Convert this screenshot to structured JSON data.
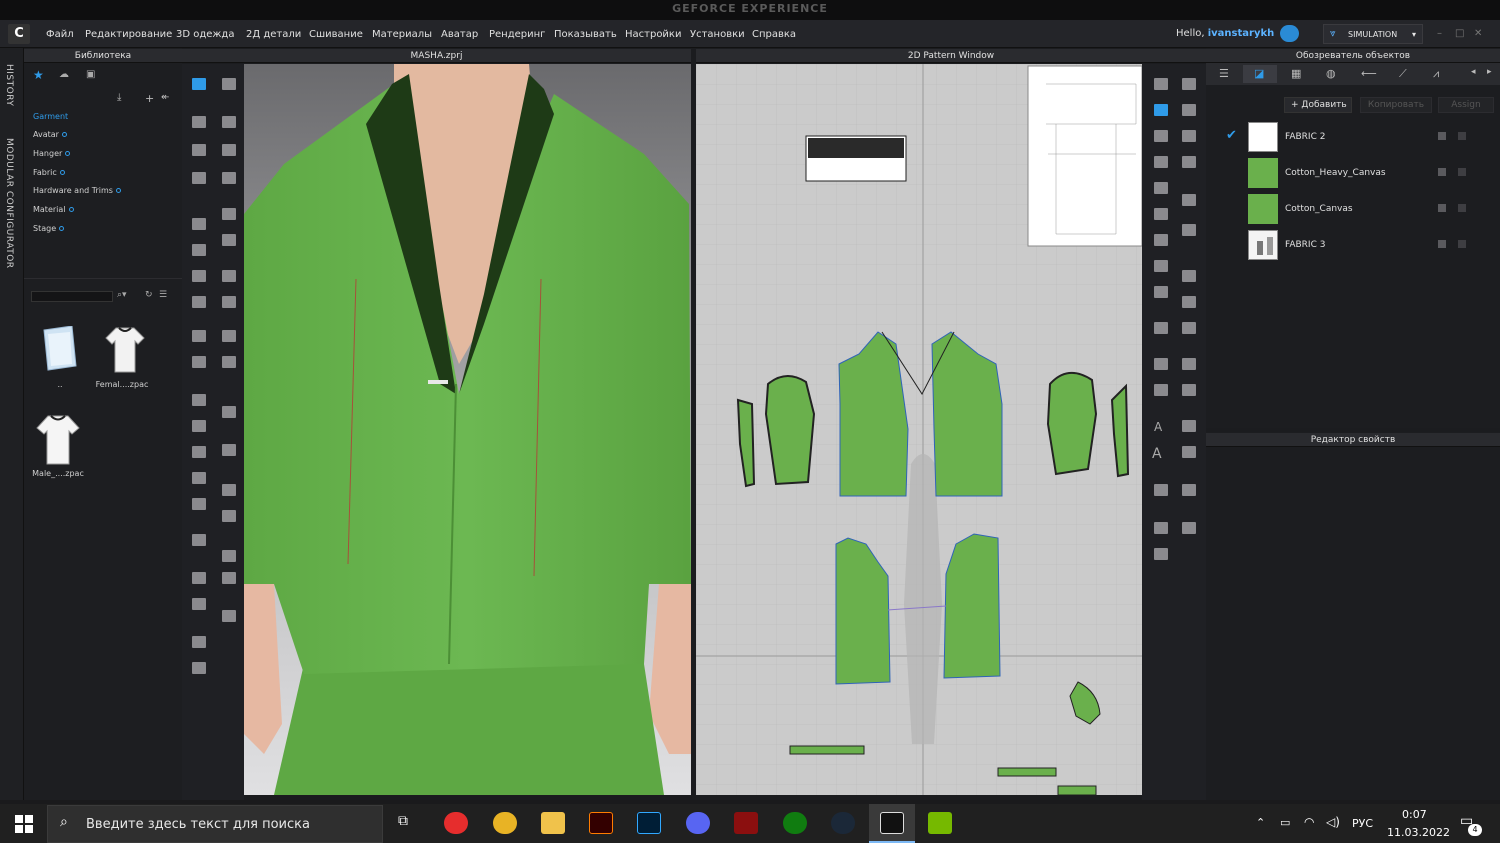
{
  "overlay": {
    "brand": "GEFORCE EXPERIENCE"
  },
  "app": {
    "logo": "C"
  },
  "menu": [
    "Файл",
    "Редактирование",
    "3D одежда",
    "2Д детали",
    "Сшивание",
    "Материалы",
    "Аватар",
    "Рендеринг",
    "Показывать",
    "Настройки",
    "Установки",
    "Справка"
  ],
  "user": {
    "greeting": "Hello,",
    "name": "ivanstarykh"
  },
  "mode": {
    "label": "SIMULATION"
  },
  "side_tabs": {
    "history": "HISTORY",
    "modular": "MODULAR CONFIGURATOR"
  },
  "library": {
    "title": "Библиотека",
    "items": [
      "Garment",
      "Avatar",
      "Hanger",
      "Fabric",
      "Hardware and Trims",
      "Material",
      "Stage"
    ],
    "active_item": "Garment",
    "files": [
      {
        "label": "..",
        "icon": "folder-icon"
      },
      {
        "label": "Femal....zpac",
        "icon": "female-tshirt-icon"
      },
      {
        "label": "Male_....zpac",
        "icon": "male-tshirt-icon"
      }
    ]
  },
  "view3d": {
    "title": "MASHA.zprj"
  },
  "pattern": {
    "title": "2D Pattern Window"
  },
  "object_browser": {
    "title": "Обозреватель объектов",
    "buttons": {
      "add": "Добавить",
      "copy": "Копировать",
      "assign": "Assign"
    },
    "fabrics": [
      {
        "name": "FABRIC 2",
        "checked": true,
        "swatch": "white-pattern"
      },
      {
        "name": "Cotton_Heavy_Canvas",
        "checked": false,
        "swatch": "#6ab04c"
      },
      {
        "name": "Cotton_Canvas",
        "checked": false,
        "swatch": "#6ab04c"
      },
      {
        "name": "FABRIC 3",
        "checked": false,
        "swatch": "print"
      }
    ]
  },
  "property_editor": {
    "title": "Редактор свойств"
  },
  "taskbar": {
    "search_placeholder": "Введите здесь текст для поиска",
    "language": "РУС",
    "time": "0:07",
    "date": "11.03.2022",
    "notifications": "4",
    "apps": [
      "yandex-icon",
      "chrome-icon",
      "explorer-icon",
      "illustrator-icon",
      "photoshop-icon",
      "discord-icon",
      "game-icon",
      "xbox-icon",
      "steam-icon",
      "clo-icon",
      "nvidia-icon"
    ]
  },
  "colors": {
    "fabric_green": "#6ab04c",
    "accent": "#2f9be8"
  }
}
